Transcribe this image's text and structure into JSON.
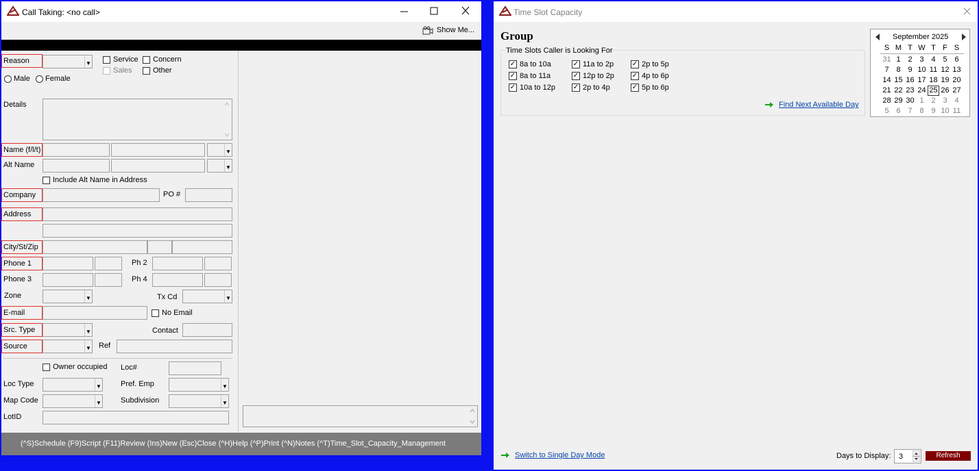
{
  "left_window": {
    "title": "Call Taking: <no call>",
    "show_me": "Show Me...",
    "fields": {
      "reason": "Reason",
      "service": "Service",
      "concern": "Concern",
      "sales": "Sales",
      "other": "Other",
      "male": "Male",
      "female": "Female",
      "details": "Details",
      "name": "Name (f/l/t)",
      "alt_name": "Alt Name",
      "include_alt": "Include Alt Name in Address",
      "company": "Company",
      "po": "PO #",
      "address": "Address",
      "city": "City/St/Zip",
      "phone1": "Phone 1",
      "ph2": "Ph 2",
      "phone3": "Phone 3",
      "ph4": "Ph 4",
      "zone": "Zone",
      "txcd": "Tx Cd",
      "email": "E-mail",
      "no_email": "No Email",
      "src_type": "Src. Type",
      "contact": "Contact",
      "source": "Source",
      "ref": "Ref",
      "owner": "Owner occupied",
      "loc_num": "Loc#",
      "loc_type": "Loc Type",
      "pref_emp": "Pref. Emp",
      "map_code": "Map Code",
      "subdivision": "Subdivision",
      "lotid": "LotID"
    },
    "status_bar": "(^S)Schedule  (F9)Script  (F11)Review  (Ins)New  (Esc)Close  (^H)Help  (^P)Print  (^N)Notes  (^T)Time_Slot_Capacity_Management"
  },
  "right_window": {
    "title": "Time Slot Capacity",
    "group": "Group",
    "fieldset_label": "Time Slots Caller is Looking For",
    "slots": [
      [
        "8a to 10a",
        "11a to 2p",
        "2p to 5p"
      ],
      [
        "8a to 11a",
        "12p to 2p",
        "4p to 6p"
      ],
      [
        "10a to 12p",
        "2p to 4p",
        "5p to 6p"
      ]
    ],
    "find_next": "Find Next Available Day",
    "switch_mode": "Switch to Single Day Mode",
    "days_label": "Days to Display:",
    "days_value": "3",
    "refresh": "Refresh",
    "calendar": {
      "month": "September 2025",
      "weekdays": [
        "S",
        "M",
        "T",
        "W",
        "T",
        "F",
        "S"
      ],
      "weeks": [
        [
          "31",
          "1",
          "2",
          "3",
          "4",
          "5",
          "6"
        ],
        [
          "7",
          "8",
          "9",
          "10",
          "11",
          "12",
          "13"
        ],
        [
          "14",
          "15",
          "16",
          "17",
          "18",
          "19",
          "20"
        ],
        [
          "21",
          "22",
          "23",
          "24",
          "25",
          "26",
          "27"
        ],
        [
          "28",
          "29",
          "30",
          "1",
          "2",
          "3",
          "4"
        ],
        [
          "5",
          "6",
          "7",
          "8",
          "9",
          "10",
          "11"
        ]
      ],
      "today": "25"
    }
  },
  "colors": {
    "desktop": "#0a12f0",
    "status_bar": "#7b7b7b",
    "refresh_bg": "#800000",
    "required_border": "#e0302f"
  }
}
